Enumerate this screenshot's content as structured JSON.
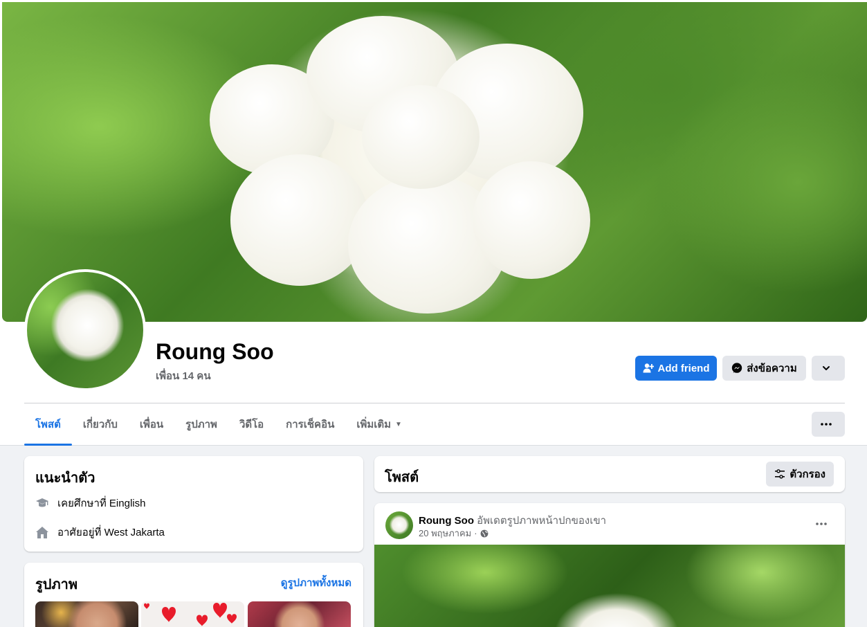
{
  "profile": {
    "name": "Roung Soo",
    "friends_count": "เพื่อน 14 คน",
    "add_friend_label": "Add friend",
    "message_label": "ส่งข้อความ"
  },
  "tabs": [
    {
      "label": "โพสต์",
      "active": true
    },
    {
      "label": "เกี่ยวกับ"
    },
    {
      "label": "เพื่อน"
    },
    {
      "label": "รูปภาพ"
    },
    {
      "label": "วิดีโอ"
    },
    {
      "label": "การเช็คอิน"
    },
    {
      "label": "เพิ่มเติม"
    }
  ],
  "intro": {
    "title": "แนะนำตัว",
    "education": "เคยศึกษาที่ Einglish",
    "lives_in": "อาศัยอยู่ที่ West Jakarta"
  },
  "photos": {
    "title": "รูปภาพ",
    "see_all": "ดูรูปภาพทั้งหมด"
  },
  "posts": {
    "title": "โพสต์",
    "filter_label": "ตัวกรอง"
  },
  "post": {
    "author": "Roung Soo",
    "action": "อัพเดตรูปภาพหน้าปกของเขา",
    "date": "20 พฤษภาคม",
    "separator": "·"
  },
  "colors": {
    "accent": "#1b74e4",
    "secondary_button": "#e4e6eb",
    "page_background": "#f0f2f5"
  }
}
